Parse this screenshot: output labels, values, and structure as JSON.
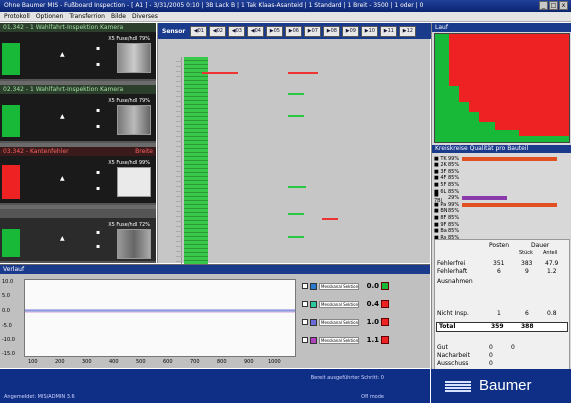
{
  "titlebar": {
    "title": "Ohne Baumer MIS - Fußboard Inspection - [ A1 ] - 3/31/2005 0:10 | 3B Lack B | 1 Tak Klaas-Asanteid | 1 Standard | 1 Breit - 3500 | 1 oder | 0",
    "min": "_",
    "max": "□",
    "close": "x"
  },
  "menu": [
    "Protokoll",
    "Optionen",
    "Transferrion",
    "Bilde",
    "Diverses"
  ],
  "cameras": [
    {
      "title": "01.342 - 1 Wahlfahrt-Inspektion Kamera",
      "value": "X5 Fuse/hdl 79%",
      "state": "ok"
    },
    {
      "title": "02.342 - 1 Wahlfahrt-Inspektion Kamera",
      "value": "X5 Fuse/hdl 79%",
      "state": "ok"
    },
    {
      "title": "03.342 - Kantenfehler",
      "side": "Breite",
      "value": "X5 Fuse/hdl 99%",
      "state": "err"
    },
    {
      "title": "",
      "value": "X5 Fuse/hdl 72%",
      "state": "gray"
    }
  ],
  "strip": {
    "label": "Sensor",
    "buttons": [
      "◀01",
      "◀02",
      "◀03",
      "◀04",
      "▶05",
      "▶06",
      "▶07",
      "▶08",
      "▶09",
      "▶10",
      "▶11",
      "▶12"
    ]
  },
  "right": {
    "heat_title": "Lauf",
    "stats_title": "Kreiskreise Qualität pro Bauteil",
    "rows": [
      {
        "k": "■ TK",
        "p": "99%",
        "c": "#e05020",
        "w": 0.95
      },
      {
        "k": "■ 2K",
        "p": "85%",
        "c": "",
        "w": 0
      },
      {
        "k": "■ 3F",
        "p": "85%",
        "c": "",
        "w": 0
      },
      {
        "k": "■ 4F",
        "p": "85%",
        "c": "",
        "w": 0
      },
      {
        "k": "■ 5F",
        "p": "85%",
        "c": "",
        "w": 0
      },
      {
        "k": "■ 6L",
        "p": "85%",
        "c": "",
        "w": 0
      },
      {
        "k": "■ 7Bl",
        "p": "29%",
        "c": "#8a3aaa",
        "w": 0.45
      },
      {
        "k": "■ Pa",
        "p": "99%",
        "c": "#e05020",
        "w": 0.95
      },
      {
        "k": "■ BN",
        "p": "85%",
        "c": "",
        "w": 0
      },
      {
        "k": "■ 8F",
        "p": "85%",
        "c": "",
        "w": 0
      },
      {
        "k": "■ 9F",
        "p": "85%",
        "c": "",
        "w": 0
      },
      {
        "k": "■ Ba",
        "p": "85%",
        "c": "",
        "w": 0
      },
      {
        "k": "■ Rs",
        "p": "85%",
        "c": "",
        "w": 0
      }
    ],
    "table": {
      "h1": "Posten",
      "h2": "Dauer",
      "h2a": "Stück",
      "h2b": "Anteil",
      "rows": [
        {
          "l": "Fehlerfrei",
          "a": "351",
          "b": "383",
          "c": "47.9"
        },
        {
          "l": "Fehlerhaft",
          "a": "6",
          "b": "9",
          "c": "1.2"
        },
        {
          "l": "Ausnahmen",
          "a": "",
          "b": "",
          "c": ""
        },
        {
          "l": "Nicht Insp.",
          "a": "1",
          "b": "6",
          "c": "0.8"
        }
      ],
      "total_label": "Total",
      "total_a": "359",
      "total_b": "388",
      "f1": "Gut",
      "f1v": "0",
      "f1w": "0",
      "f2": "Nacharbeit",
      "f2v": "0",
      "f3": "Ausschuss",
      "f3v": "0"
    }
  },
  "plot": {
    "title": "Verlauf",
    "yticks": [
      "10.0",
      "5.0",
      "0.0",
      "-5.0",
      "-10.0",
      "-15.0"
    ],
    "xticks": [
      "100",
      "200",
      "300",
      "400",
      "500",
      "600",
      "700",
      "800",
      "900",
      "1000"
    ],
    "legend": [
      {
        "name": "Messkanal Sektion1",
        "color": "#2a7ad0",
        "value": "0.0",
        "state_color": "#18b838"
      },
      {
        "name": "Messkanal Sektion2",
        "color": "#28c8a0",
        "value": "0.4",
        "state_color": "#e22"
      },
      {
        "name": "Messkanal Sektion3",
        "color": "#6a6ad8",
        "value": "1.0",
        "state_color": "#e22"
      },
      {
        "name": "Messkanal Sektion4",
        "color": "#b040c0",
        "value": "1.1",
        "state_color": "#e22"
      }
    ]
  },
  "status": {
    "left": "Angemeldet: MIS/ADMIN 3.6",
    "mid": "Bereit ausgeführter Schritt: 0",
    "right": "Ofl mode"
  },
  "brand": {
    "name": "Baumer"
  }
}
